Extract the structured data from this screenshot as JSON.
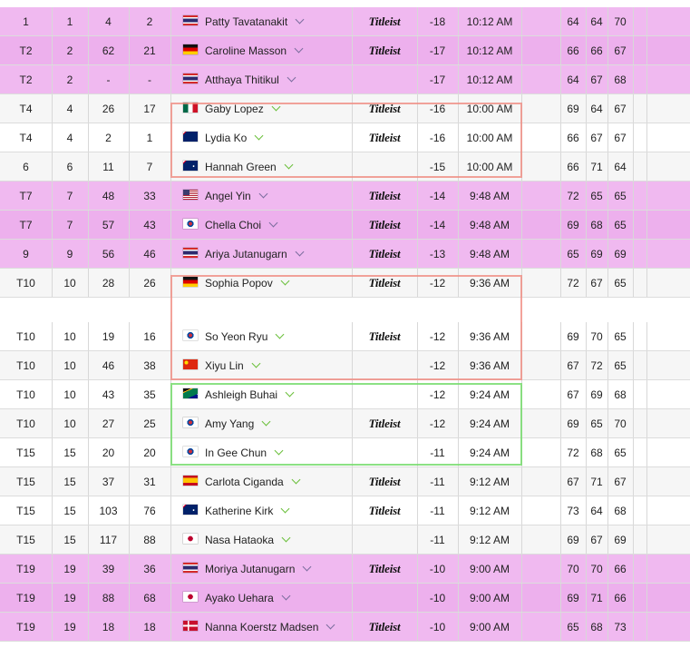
{
  "leaderboard": {
    "rows_top": [
      {
        "pos": "1",
        "c2": "1",
        "c3": "4",
        "c4": "2",
        "flag": "thailand",
        "name": "Patty Tavatanakit",
        "sponsor": "Titleist",
        "score": "-18",
        "time": "10:12 AM",
        "r1": "64",
        "r2": "64",
        "r3": "70",
        "hl": "pink"
      },
      {
        "pos": "T2",
        "c2": "2",
        "c3": "62",
        "c4": "21",
        "flag": "germany",
        "name": "Caroline Masson",
        "sponsor": "Titleist",
        "score": "-17",
        "time": "10:12 AM",
        "r1": "66",
        "r2": "66",
        "r3": "67",
        "hl": "pink"
      },
      {
        "pos": "T2",
        "c2": "2",
        "c3": "-",
        "c4": "-",
        "flag": "thailand",
        "name": "Atthaya Thitikul",
        "sponsor": "",
        "score": "-17",
        "time": "10:12 AM",
        "r1": "64",
        "r2": "67",
        "r3": "68",
        "hl": "pink"
      },
      {
        "pos": "T4",
        "c2": "4",
        "c3": "26",
        "c4": "17",
        "flag": "mexico",
        "name": "Gaby Lopez",
        "sponsor": "Titleist",
        "score": "-16",
        "time": "10:00 AM",
        "r1": "69",
        "r2": "64",
        "r3": "67",
        "hl": "white"
      },
      {
        "pos": "T4",
        "c2": "4",
        "c3": "2",
        "c4": "1",
        "flag": "new-zealand",
        "name": "Lydia Ko",
        "sponsor": "Titleist",
        "score": "-16",
        "time": "10:00 AM",
        "r1": "66",
        "r2": "67",
        "r3": "67",
        "hl": "white"
      },
      {
        "pos": "6",
        "c2": "6",
        "c3": "11",
        "c4": "7",
        "flag": "australia",
        "name": "Hannah Green",
        "sponsor": "",
        "score": "-15",
        "time": "10:00 AM",
        "r1": "66",
        "r2": "71",
        "r3": "64",
        "hl": "white"
      },
      {
        "pos": "T7",
        "c2": "7",
        "c3": "48",
        "c4": "33",
        "flag": "usa",
        "name": "Angel Yin",
        "sponsor": "Titleist",
        "score": "-14",
        "time": "9:48 AM",
        "r1": "72",
        "r2": "65",
        "r3": "65",
        "hl": "pink"
      },
      {
        "pos": "T7",
        "c2": "7",
        "c3": "57",
        "c4": "43",
        "flag": "korea",
        "name": "Chella Choi",
        "sponsor": "Titleist",
        "score": "-14",
        "time": "9:48 AM",
        "r1": "69",
        "r2": "68",
        "r3": "65",
        "hl": "pink"
      },
      {
        "pos": "9",
        "c2": "9",
        "c3": "56",
        "c4": "46",
        "flag": "thailand",
        "name": "Ariya Jutanugarn",
        "sponsor": "Titleist",
        "score": "-13",
        "time": "9:48 AM",
        "r1": "65",
        "r2": "69",
        "r3": "69",
        "hl": "pink"
      },
      {
        "pos": "T10",
        "c2": "10",
        "c3": "28",
        "c4": "26",
        "flag": "germany",
        "name": "Sophia Popov",
        "sponsor": "Titleist",
        "score": "-12",
        "time": "9:36 AM",
        "r1": "72",
        "r2": "67",
        "r3": "65",
        "hl": "white"
      }
    ],
    "rows_bottom": [
      {
        "pos": "T10",
        "c2": "10",
        "c3": "19",
        "c4": "16",
        "flag": "korea",
        "name": "So Yeon Ryu",
        "sponsor": "Titleist",
        "score": "-12",
        "time": "9:36 AM",
        "r1": "69",
        "r2": "70",
        "r3": "65",
        "hl": "white"
      },
      {
        "pos": "T10",
        "c2": "10",
        "c3": "46",
        "c4": "38",
        "flag": "china",
        "name": "Xiyu Lin",
        "sponsor": "",
        "score": "-12",
        "time": "9:36 AM",
        "r1": "67",
        "r2": "72",
        "r3": "65",
        "hl": "white"
      },
      {
        "pos": "T10",
        "c2": "10",
        "c3": "43",
        "c4": "35",
        "flag": "south-africa",
        "name": "Ashleigh Buhai",
        "sponsor": "",
        "score": "-12",
        "time": "9:24 AM",
        "r1": "67",
        "r2": "69",
        "r3": "68",
        "hl": "white"
      },
      {
        "pos": "T10",
        "c2": "10",
        "c3": "27",
        "c4": "25",
        "flag": "korea",
        "name": "Amy Yang",
        "sponsor": "Titleist",
        "score": "-12",
        "time": "9:24 AM",
        "r1": "69",
        "r2": "65",
        "r3": "70",
        "hl": "white"
      },
      {
        "pos": "T15",
        "c2": "15",
        "c3": "20",
        "c4": "20",
        "flag": "korea",
        "name": "In Gee Chun",
        "sponsor": "",
        "score": "-11",
        "time": "9:24 AM",
        "r1": "72",
        "r2": "68",
        "r3": "65",
        "hl": "white"
      },
      {
        "pos": "T15",
        "c2": "15",
        "c3": "37",
        "c4": "31",
        "flag": "spain",
        "name": "Carlota Ciganda",
        "sponsor": "Titleist",
        "score": "-11",
        "time": "9:12 AM",
        "r1": "67",
        "r2": "71",
        "r3": "67",
        "hl": "white"
      },
      {
        "pos": "T15",
        "c2": "15",
        "c3": "103",
        "c4": "76",
        "flag": "australia",
        "name": "Katherine Kirk",
        "sponsor": "Titleist",
        "score": "-11",
        "time": "9:12 AM",
        "r1": "73",
        "r2": "64",
        "r3": "68",
        "hl": "white"
      },
      {
        "pos": "T15",
        "c2": "15",
        "c3": "117",
        "c4": "88",
        "flag": "japan",
        "name": "Nasa Hataoka",
        "sponsor": "",
        "score": "-11",
        "time": "9:12 AM",
        "r1": "69",
        "r2": "67",
        "r3": "69",
        "hl": "white"
      },
      {
        "pos": "T19",
        "c2": "19",
        "c3": "39",
        "c4": "36",
        "flag": "thailand",
        "name": "Moriya Jutanugarn",
        "sponsor": "Titleist",
        "score": "-10",
        "time": "9:00 AM",
        "r1": "70",
        "r2": "70",
        "r3": "66",
        "hl": "pink"
      },
      {
        "pos": "T19",
        "c2": "19",
        "c3": "88",
        "c4": "68",
        "flag": "japan",
        "name": "Ayako Uehara",
        "sponsor": "",
        "score": "-10",
        "time": "9:00 AM",
        "r1": "69",
        "r2": "71",
        "r3": "66",
        "hl": "pink"
      },
      {
        "pos": "T19",
        "c2": "19",
        "c3": "18",
        "c4": "18",
        "flag": "denmark",
        "name": "Nanna Koerstz Madsen",
        "sponsor": "Titleist",
        "score": "-10",
        "time": "9:00 AM",
        "r1": "65",
        "r2": "68",
        "r3": "73",
        "hl": "pink"
      }
    ]
  },
  "colors": {
    "pink_row": "#f0b9f0",
    "chevron_green": "#6abf3a",
    "highlight_red": "#f08c82",
    "highlight_green": "#78dc6e"
  }
}
